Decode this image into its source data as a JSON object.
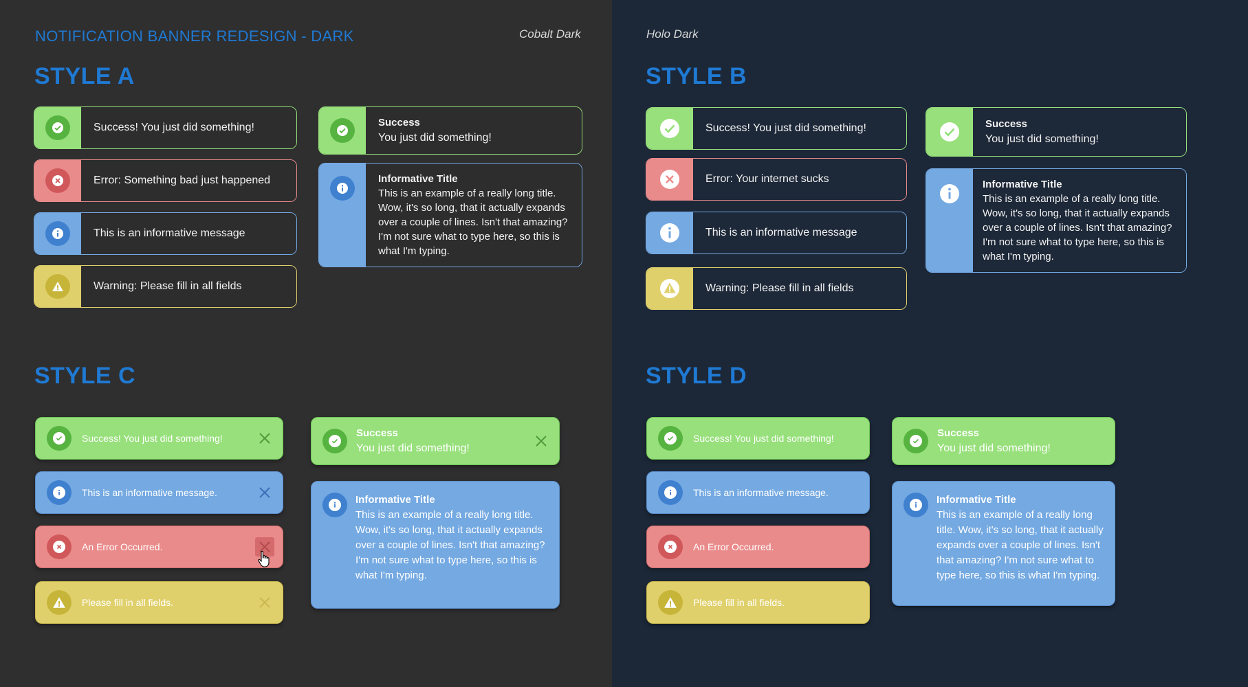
{
  "header": {
    "title": "NOTIFICATION BANNER REDESIGN - DARK",
    "left_theme": "Cobalt Dark",
    "right_theme": "Holo Dark"
  },
  "styles": {
    "a": "STYLE A",
    "b": "STYLE B",
    "c": "STYLE C",
    "d": "STYLE D"
  },
  "style_a": {
    "success": "Success! You just did something!",
    "error": "Error: Something bad just happened",
    "info": "This is an informative message",
    "warning": "Warning: Please fill in all fields",
    "success_title": "Success",
    "success_text": "You just did something!",
    "info_title": "Informative Title",
    "info_text": "This is an example of a really long title. Wow, it's so long, that it actually expands over a couple of lines. Isn't that amazing? I'm not sure what to type here, so this is what I'm typing."
  },
  "style_b": {
    "success": "Success! You just did something!",
    "error": "Error: Your internet sucks",
    "info": "This is an informative message",
    "warning": "Warning: Please fill in all fields",
    "success_title": "Success",
    "success_text": "You just did something!",
    "info_title": "Informative Title",
    "info_text": "This is an example of a really long title. Wow, it's so long, that it actually expands over a couple of lines. Isn't that amazing? I'm not sure what to type here, so this is what I'm typing."
  },
  "style_c": {
    "success": "Success! You just did something!",
    "info": "This is an informative message.",
    "error": "An Error Occurred.",
    "warning": "Please fill in all fields.",
    "success_title": "Success",
    "success_text": "You just did something!",
    "info_title": "Informative Title",
    "info_text": "This is an example of a really long title. Wow, it's so long, that it actually expands over a couple of lines. Isn't that amazing? I'm not sure what to type here, so this is what I'm typing."
  },
  "style_d": {
    "success": "Success! You just did something!",
    "info": "This is an informative message.",
    "error": "An Error Occurred.",
    "warning": "Please fill in all fields.",
    "success_title": "Success",
    "success_text": "You just did something!",
    "info_title": "Informative Title",
    "info_text": "This is an example of a really long title. Wow, it's so long, that it actually expands over a couple of lines. Isn't that amazing? I'm not sure what to type here, so this is what I'm typing."
  },
  "colors": {
    "accent": "#1f7ad4",
    "success": "#97e07b",
    "error": "#ea8b8b",
    "info": "#74a9e2",
    "warning": "#e0d06b",
    "left_bg": "#2f2f30",
    "right_bg": "#1c2838"
  },
  "icons": [
    "check-icon",
    "error-x-icon",
    "info-icon",
    "warning-icon",
    "close-icon",
    "cursor-hand-icon"
  ]
}
